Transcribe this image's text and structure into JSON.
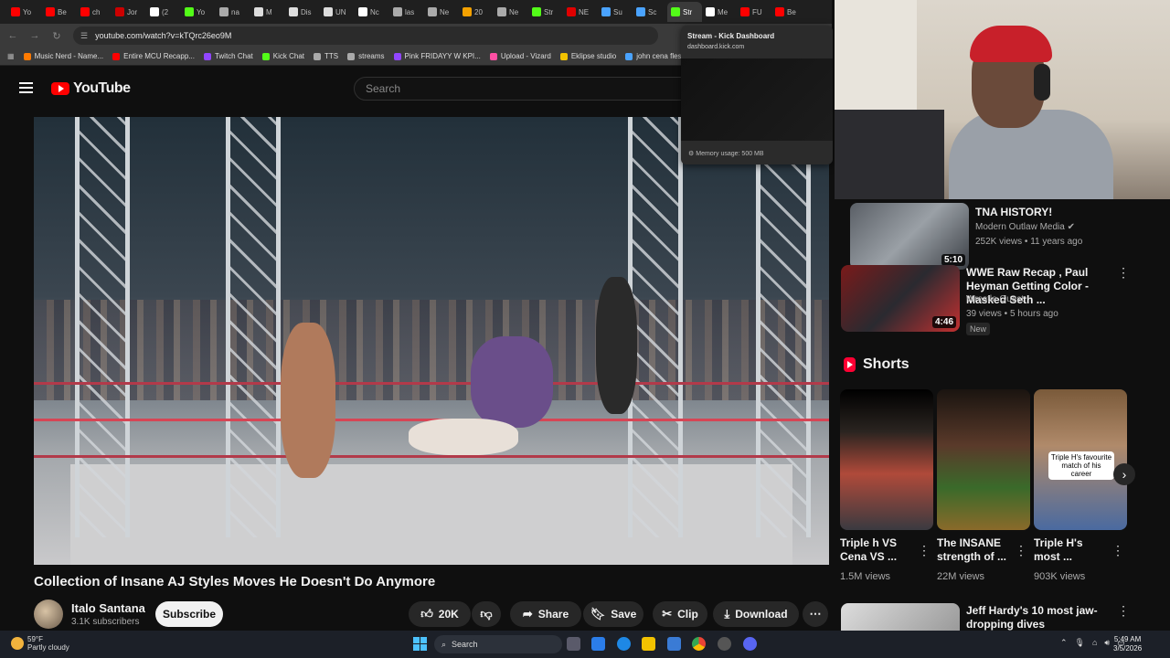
{
  "browser": {
    "tabs": [
      {
        "label": "Yo",
        "color": "#ff0000"
      },
      {
        "label": "Be",
        "color": "#ff0000"
      },
      {
        "label": "ch",
        "color": "#ff0000"
      },
      {
        "label": "Jor",
        "color": "#cc0000"
      },
      {
        "label": "(2",
        "color": "#ffffff"
      },
      {
        "label": "Yo",
        "color": "#53fc18"
      },
      {
        "label": "na",
        "color": "#aaaaaa"
      },
      {
        "label": "M",
        "color": "#dddddd"
      },
      {
        "label": "Dis",
        "color": "#dddddd"
      },
      {
        "label": "UN",
        "color": "#dddddd"
      },
      {
        "label": "Nc",
        "color": "#ffffff"
      },
      {
        "label": "las",
        "color": "#aaaaaa"
      },
      {
        "label": "Ne",
        "color": "#aaaaaa"
      },
      {
        "label": "20",
        "color": "#f4a100"
      },
      {
        "label": "Ne",
        "color": "#aaaaaa"
      },
      {
        "label": "Str",
        "color": "#53fc18"
      },
      {
        "label": "NE",
        "color": "#e00000"
      },
      {
        "label": "Su",
        "color": "#4aa3ff"
      },
      {
        "label": "Sc",
        "color": "#4aa3ff"
      },
      {
        "label": "Str",
        "color": "#53fc18"
      },
      {
        "label": "Me",
        "color": "#ffffff"
      },
      {
        "label": "FU",
        "color": "#ff0000"
      },
      {
        "label": "Be",
        "color": "#ff0000"
      }
    ],
    "active_tab_index": 19,
    "url": "youtube.com/watch?v=kTQrc26eo9M",
    "bookmarks": [
      {
        "label": "Music Nerd - Name...",
        "color": "#ff7a00"
      },
      {
        "label": "Entire MCU Recapp...",
        "color": "#ff0000"
      },
      {
        "label": "Twitch Chat",
        "color": "#9146ff"
      },
      {
        "label": "Kick Chat",
        "color": "#53fc18"
      },
      {
        "label": "TTS",
        "color": "#aaaaaa"
      },
      {
        "label": "streams",
        "color": "#aaaaaa"
      },
      {
        "label": "Pink FRIDAYY W KPI...",
        "color": "#9146ff"
      },
      {
        "label": "Upload - Vizard",
        "color": "#ff4fa3"
      },
      {
        "label": "Eklipse studio",
        "color": "#f2c200"
      },
      {
        "label": "john cena fleshlig...",
        "color": "#4aa3ff"
      }
    ]
  },
  "hover_card": {
    "title": "Stream - Kick Dashboard",
    "url": "dashboard.kick.com",
    "memory": "Memory usage: 500 MB"
  },
  "youtube": {
    "logo_text": "YouTube",
    "search_placeholder": "Search",
    "video_title": "Collection of Insane AJ Styles Moves He Doesn't Do Anymore",
    "channel": "Italo Santana",
    "subscribers": "3.1K subscribers",
    "subscribe_label": "Subscribe",
    "likes": "20K",
    "share_label": "Share",
    "save_label": "Save",
    "clip_label": "Clip",
    "download_label": "Download"
  },
  "related": [
    {
      "title": "TNA HISTORY!",
      "channel": "Modern Outlaw Media",
      "meta": "252K views • 11 years ago",
      "duration": "5:10",
      "verified": true,
      "new": false
    },
    {
      "title": "WWE Raw Recap , Paul Heyman Getting Color - Masked Seth ...",
      "channel": "Wrestle Quest",
      "meta": "39 views • 5 hours ago",
      "duration": "4:46",
      "verified": false,
      "new": true,
      "new_label": "New"
    },
    {
      "title": "Jeff Hardy's 10 most jaw-dropping dives",
      "channel": "",
      "meta": "",
      "duration": "",
      "verified": false,
      "new": false
    }
  ],
  "shorts": {
    "heading": "Shorts",
    "items": [
      {
        "title": "Triple h VS Cena VS ...",
        "views": "1.5M views"
      },
      {
        "title": "The INSANE strength of ...",
        "views": "22M views"
      },
      {
        "title": "Triple H's most ...",
        "views": "903K views",
        "overlay": "Triple H's favourite match of his career"
      }
    ]
  },
  "taskbar": {
    "temperature": "59°F",
    "weather": "Partly cloudy",
    "search_label": "Search",
    "time": "5:49 AM",
    "date": "3/5/2026"
  },
  "colors": {
    "yt_red": "#ff0000",
    "kick_green": "#53fc18",
    "bg": "#0f0f0f"
  }
}
